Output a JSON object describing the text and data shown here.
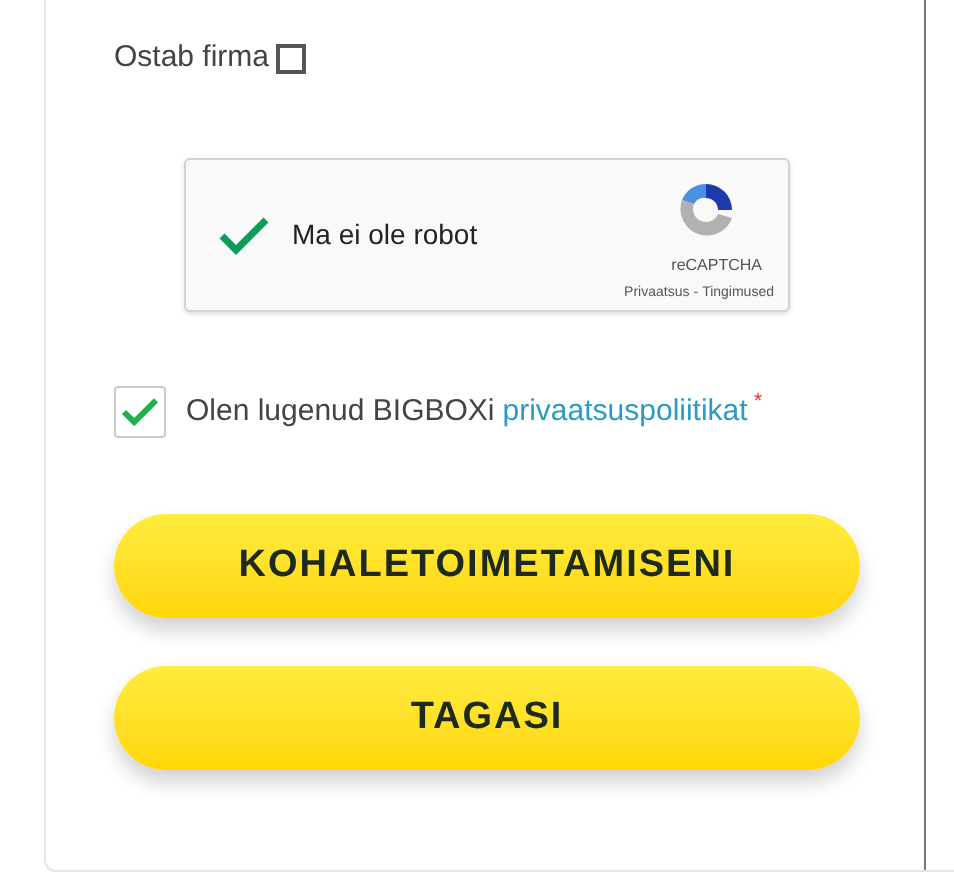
{
  "company_checkbox": {
    "label": "Ostab firma",
    "checked": false
  },
  "captcha": {
    "label": "Ma ei ole robot",
    "checked": true,
    "brand": "reCAPTCHA",
    "privacy_link": "Privaatsus",
    "separator": "-",
    "terms_link": "Tingimused"
  },
  "privacy_consent": {
    "text": "Olen lugenud BIGBOXi",
    "link": "privaatsuspoliitikat",
    "required": true,
    "required_mark": "*",
    "checked": true
  },
  "buttons": [
    {
      "label": "KOHALETOIMETAMISENI"
    },
    {
      "label": "TAGASI"
    }
  ]
}
